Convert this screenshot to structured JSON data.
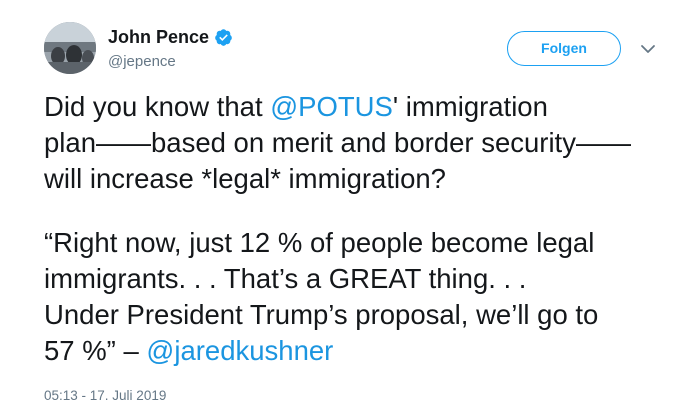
{
  "author": {
    "display_name": "John Pence",
    "handle": "@jepence",
    "verified": true
  },
  "follow_button_label": "Folgen",
  "colors": {
    "accent": "#1da1f2",
    "mention": "#1b95e0",
    "text": "#14171a",
    "muted": "#657786"
  },
  "tweet": {
    "paragraph1": {
      "line1_prefix": "Did you know that ",
      "line1_mention": "@POTUS",
      "line1_suffix": "' immigration",
      "line2": "plan——based on merit and border security——",
      "line3": "will increase *legal* immigration?"
    },
    "paragraph2": {
      "line1": "“Right now, just 12 % of people become legal",
      "line2": "immigrants.  . . That’s a GREAT thing. . .",
      "line3": "Under President Trump’s proposal, we’ll go to",
      "line4_prefix": "57 %” – ",
      "line4_mention": "@jaredkushner"
    }
  },
  "timestamp": "05:13 - 17. Juli 2019"
}
